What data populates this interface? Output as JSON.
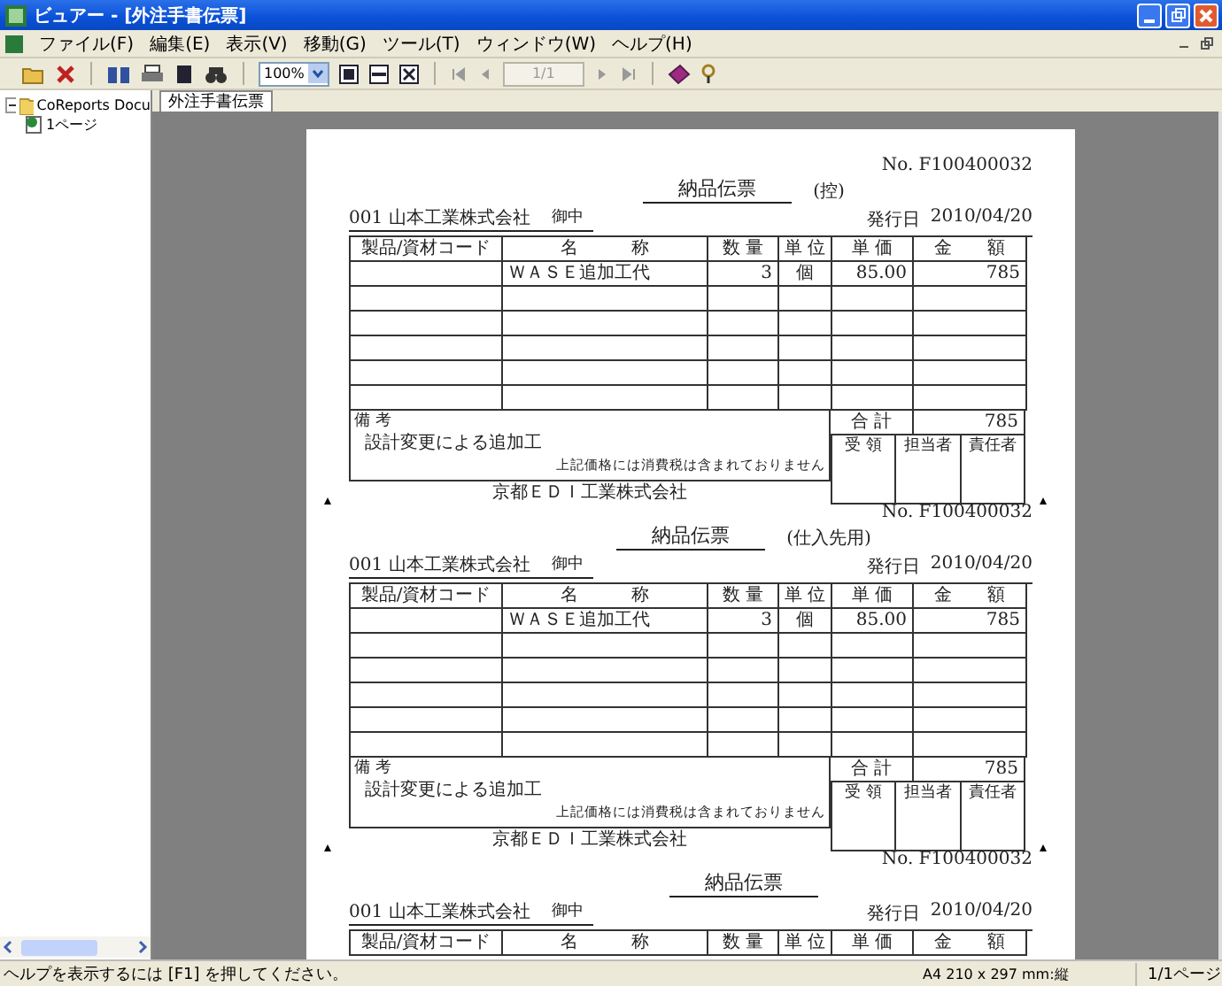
{
  "window": {
    "title": "ビュアー - [外注手書伝票]"
  },
  "menu": [
    "ファイル(F)",
    "編集(E)",
    "表示(V)",
    "移動(G)",
    "ツール(T)",
    "ウィンドウ(W)",
    "ヘルプ(H)"
  ],
  "toolbar": {
    "zoom": "100%",
    "page": "1/1"
  },
  "tree": {
    "label": "CoReports Docu",
    "expanded": true,
    "children": [
      {
        "label": "1ページ"
      }
    ]
  },
  "tabs": [
    {
      "label": "外注手書伝票",
      "selected": true
    }
  ],
  "slips": [
    {
      "crop_marks": false,
      "title": "納品伝票",
      "subtitle": "(控)",
      "number": "No. F100400032",
      "customer": "001 山本工業株式会社",
      "honorific": "御中",
      "date_label": "発行日",
      "date": "2010/04/20",
      "columns": [
        "製品/資材コード",
        "名　　　称",
        "数 量",
        "単 位",
        "単 価",
        "金　　額"
      ],
      "rows": [
        {
          "name": "ＷＡＳＥ追加工代",
          "qty": "3",
          "unit": "個",
          "price": "85.00",
          "amount": "785"
        }
      ],
      "remarks_label": "備 考",
      "remarks": "設計変更による追加工",
      "tax_note": "上記価格には消費税は含まれておりません",
      "total_label": "合 計",
      "total": "785",
      "stamps": [
        "受 領",
        "担当者",
        "責任者"
      ],
      "issuer": "京都ＥＤＩ工業株式会社"
    },
    {
      "crop_marks": true,
      "title": "納品伝票",
      "subtitle": "(仕入先用)",
      "number": "No. F100400032",
      "customer": "001 山本工業株式会社",
      "honorific": "御中",
      "date_label": "発行日",
      "date": "2010/04/20",
      "columns": [
        "製品/資材コード",
        "名　　　称",
        "数 量",
        "単 位",
        "単 価",
        "金　　額"
      ],
      "rows": [
        {
          "name": "ＷＡＳＥ追加工代",
          "qty": "3",
          "unit": "個",
          "price": "85.00",
          "amount": "785"
        }
      ],
      "remarks_label": "備 考",
      "remarks": "設計変更による追加工",
      "tax_note": "上記価格には消費税は含まれておりません",
      "total_label": "合 計",
      "total": "785",
      "stamps": [
        "受 領",
        "担当者",
        "責任者"
      ],
      "issuer": "京都ＥＤＩ工業株式会社"
    },
    {
      "crop_marks": true,
      "title": "納品伝票",
      "number": "No. F100400032",
      "customer": "001 山本工業株式会社",
      "honorific": "御中",
      "date_label": "発行日",
      "date": "2010/04/20",
      "columns": [
        "製品/資材コード",
        "名　　　称",
        "数 量",
        "単 位",
        "単 価",
        "金　　額"
      ]
    }
  ],
  "status_bar": {
    "help": "ヘルプを表示するには [F1] を押してください。",
    "paper": "A4 210 x 297 mm:縦",
    "page": "1/1ページ"
  }
}
